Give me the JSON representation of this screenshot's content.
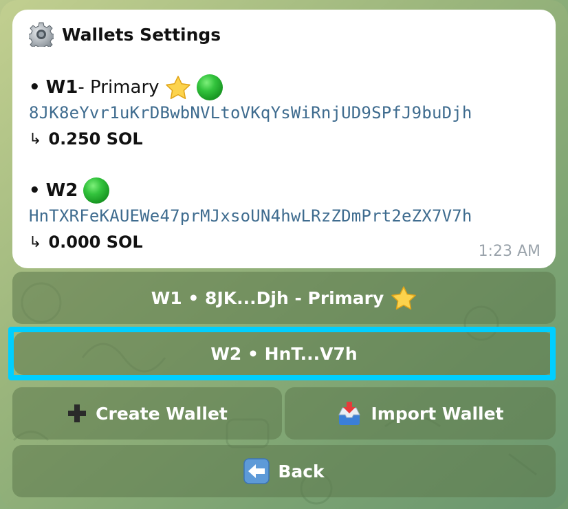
{
  "message": {
    "title": "Wallets Settings",
    "title_icon": "gear-icon",
    "wallets": [
      {
        "bullet": "•",
        "name": "W1",
        "label": " - Primary",
        "primary_icon": "star-icon",
        "status_icon": "green-circle-icon",
        "status_color": "#33c33d",
        "address": "8JK8eYvr1uKrDBwbNVLtoVKqYsWiRnjUD9SPfJ9buDjh",
        "balance_arrow": "↳",
        "balance": "0.250 SOL"
      },
      {
        "bullet": "•",
        "name": "W2",
        "label": "",
        "status_icon": "green-circle-icon",
        "status_color": "#33c33d",
        "address": "HnTXRFeKAUEWe47prMJxsoUN4hwLRzZDmPrt2eZX7V7h",
        "balance_arrow": "↳",
        "balance": "0.000 SOL"
      }
    ],
    "time": "1:23 AM"
  },
  "keyboard": {
    "w1_button": "W1 • 8JK...Djh - Primary",
    "w2_button": "W2 • HnT...V7h",
    "create_button": "Create Wallet",
    "import_button": "Import Wallet",
    "back_button": "Back",
    "selected": "W2 • HnT...V7h",
    "highlight_color": "#00cfff"
  }
}
